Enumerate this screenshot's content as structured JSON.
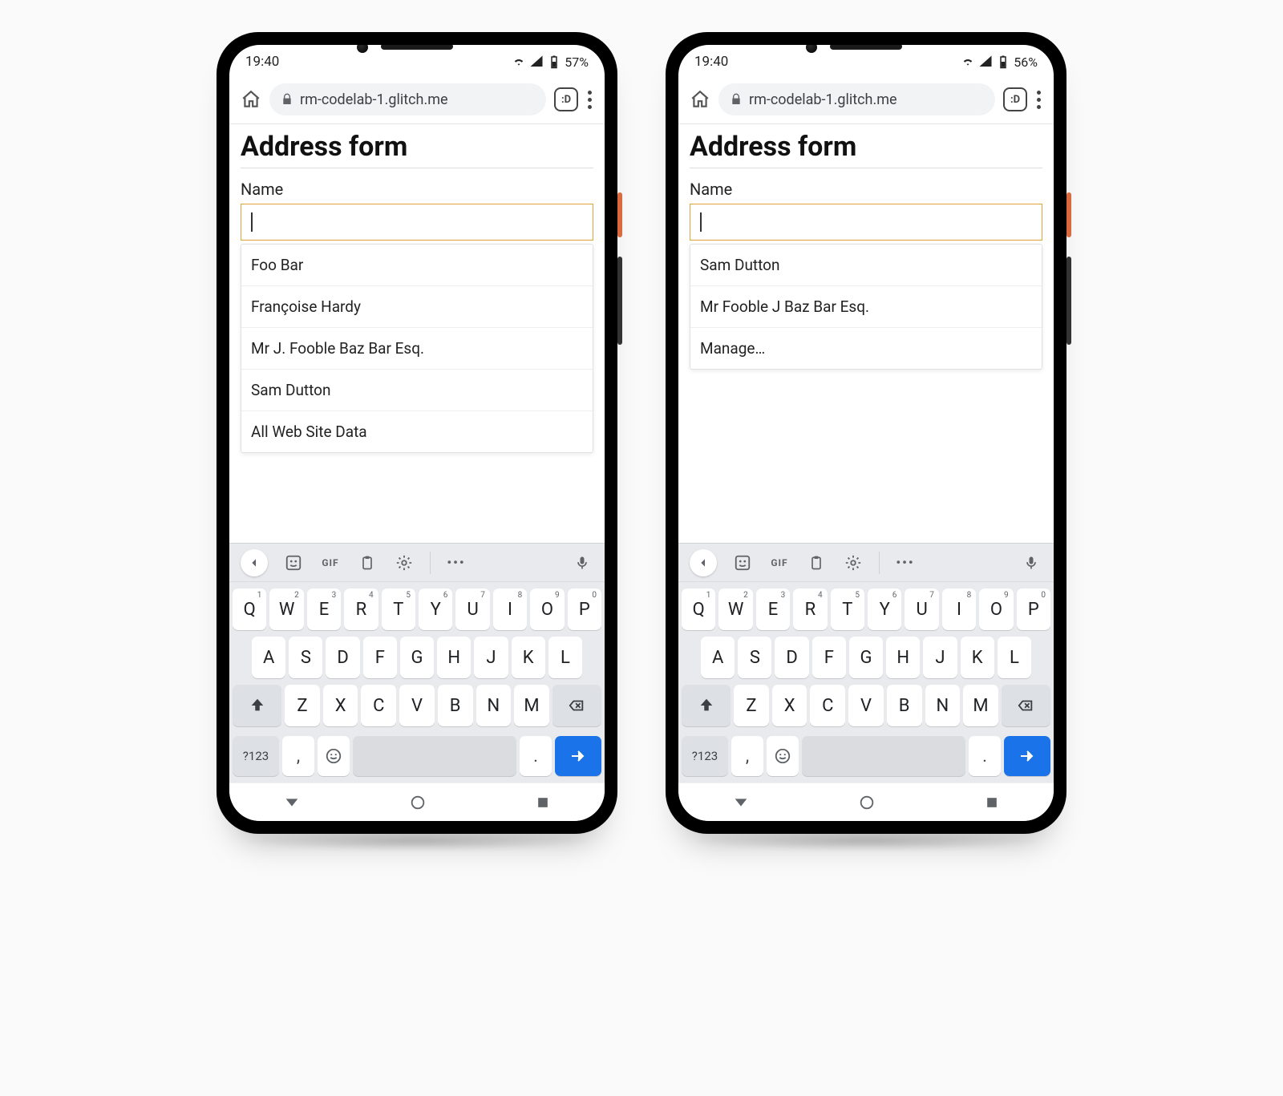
{
  "phones": [
    {
      "statusbar": {
        "time": "19:40",
        "battery_text": "57%"
      },
      "browser": {
        "url": "rm-codelab-1.glitch.me",
        "tab_badge": ":D"
      },
      "page": {
        "title": "Address form",
        "field_label": "Name",
        "suggestions": [
          "Foo Bar",
          "Françoise Hardy",
          "Mr J. Fooble Baz Bar Esq.",
          "Sam Dutton",
          "All Web Site Data"
        ]
      }
    },
    {
      "statusbar": {
        "time": "19:40",
        "battery_text": "56%"
      },
      "browser": {
        "url": "rm-codelab-1.glitch.me",
        "tab_badge": ":D"
      },
      "page": {
        "title": "Address form",
        "field_label": "Name",
        "suggestions": [
          "Sam Dutton",
          "Mr Fooble J Baz Bar Esq.",
          "Manage…"
        ]
      }
    }
  ],
  "keyboard": {
    "toolbar": {
      "gif_label": "GIF"
    },
    "rows": {
      "top": [
        {
          "k": "Q",
          "n": "1"
        },
        {
          "k": "W",
          "n": "2"
        },
        {
          "k": "E",
          "n": "3"
        },
        {
          "k": "R",
          "n": "4"
        },
        {
          "k": "T",
          "n": "5"
        },
        {
          "k": "Y",
          "n": "6"
        },
        {
          "k": "U",
          "n": "7"
        },
        {
          "k": "I",
          "n": "8"
        },
        {
          "k": "O",
          "n": "9"
        },
        {
          "k": "P",
          "n": "0"
        }
      ],
      "middle": [
        "A",
        "S",
        "D",
        "F",
        "G",
        "H",
        "J",
        "K",
        "L"
      ],
      "bottom": [
        "Z",
        "X",
        "C",
        "V",
        "B",
        "N",
        "M"
      ]
    },
    "sym_label": "?123",
    "comma": ",",
    "period": "."
  }
}
